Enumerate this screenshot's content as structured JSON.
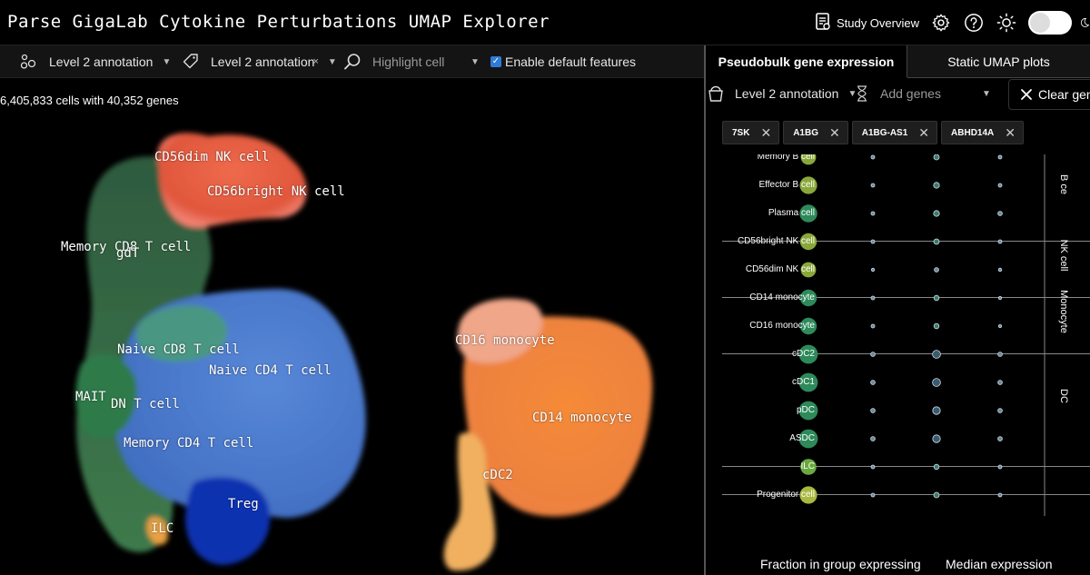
{
  "header": {
    "title": "Parse GigaLab Cytokine Perturbations UMAP Explorer",
    "study_overview": "Study Overview",
    "icons": [
      "document-icon",
      "gear-icon",
      "help-icon",
      "sun-icon",
      "theme-toggle"
    ]
  },
  "toolbar": {
    "color_by": "Level 2 annotation",
    "label_by": "Level 2 annotation",
    "highlight_placeholder": "Highlight cell",
    "enable_default_features": "Enable default features",
    "enable_default_checked": true
  },
  "umap": {
    "cell_count": "6,405,833 cells with 40,352 genes",
    "labels": {
      "cd56dim": "CD56dim NK cell",
      "cd56bright": "CD56bright NK cell",
      "memory_cd8": "Memory CD8 T cell",
      "gdt": "gdT",
      "naive_cd8": "Naive CD8 T cell",
      "naive_cd4": "Naive CD4 T cell",
      "mait": "MAIT",
      "dn": "DN T cell",
      "memory_cd4": "Memory CD4 T cell",
      "treg": "Treg",
      "ilc": "ILC",
      "cd16mono": "CD16 monocyte",
      "cd14mono": "CD14 monocyte",
      "cdc2": "cDC2"
    },
    "cluster_colors": {
      "nk": "#e8644a",
      "t_green": "#3e7a4c",
      "t_blue": "#4f7ed0",
      "treg": "#1438b8",
      "ilc": "#e09a3a",
      "monocyte": "#f08a3c",
      "cd16": "#f0a080",
      "cdc": "#f0c060"
    }
  },
  "panel": {
    "tabs": [
      "Pseudobulk gene expression",
      "Static UMAP plots"
    ],
    "group_by": "Level 2 annotation",
    "add_genes_placeholder": "Add genes",
    "clear_genes": "Clear genes",
    "genes": [
      "7SK",
      "A1BG",
      "A1BG-AS1",
      "ABHD14A"
    ],
    "rows": [
      {
        "label": "Memory B cell",
        "frac": 0.55,
        "color": "#8aa83a",
        "expr": [
          0.2,
          0.45,
          0.2
        ]
      },
      {
        "label": "Effector B cell",
        "frac": 0.7,
        "color": "#8aa83a",
        "expr": [
          0.2,
          0.5,
          0.2
        ]
      },
      {
        "label": "Plasma cell",
        "frac": 0.72,
        "color": "#2e8a5a",
        "expr": [
          0.2,
          0.5,
          0.3
        ]
      },
      {
        "label": "CD56bright NK cell",
        "frac": 0.65,
        "color": "#8aa83a",
        "expr": [
          0.2,
          0.45,
          0.2
        ]
      },
      {
        "label": "CD56dim NK cell",
        "frac": 0.55,
        "color": "#8aa83a",
        "expr": [
          0.12,
          0.3,
          0.15
        ]
      },
      {
        "label": "CD14 monocyte",
        "frac": 0.65,
        "color": "#2e8a5a",
        "expr": [
          0.2,
          0.4,
          0.1
        ]
      },
      {
        "label": "CD16 monocyte",
        "frac": 0.65,
        "color": "#2e8a5a",
        "expr": [
          0.2,
          0.4,
          0.1
        ]
      },
      {
        "label": "cDC2",
        "frac": 0.8,
        "color": "#2e8a5a",
        "expr": [
          0.3,
          0.8,
          0.3
        ]
      },
      {
        "label": "cDC1",
        "frac": 0.8,
        "color": "#2e8a5a",
        "expr": [
          0.3,
          0.8,
          0.3
        ]
      },
      {
        "label": "pDC",
        "frac": 0.8,
        "color": "#2e8a5a",
        "expr": [
          0.3,
          0.75,
          0.3
        ]
      },
      {
        "label": "ASDC",
        "frac": 0.8,
        "color": "#2e8a5a",
        "expr": [
          0.3,
          0.75,
          0.3
        ]
      },
      {
        "label": "ILC",
        "frac": 0.6,
        "color": "#6aa840",
        "expr": [
          0.2,
          0.4,
          0.2
        ]
      },
      {
        "label": "Progenitor cell",
        "frac": 0.7,
        "color": "#a8b840",
        "expr": [
          0.2,
          0.45,
          0.2
        ]
      }
    ],
    "groups": [
      "B ce",
      "NK cell",
      "Monocyte",
      "DC"
    ],
    "footer": {
      "fraction": "Fraction in group expressing",
      "median": "Median expression"
    }
  }
}
